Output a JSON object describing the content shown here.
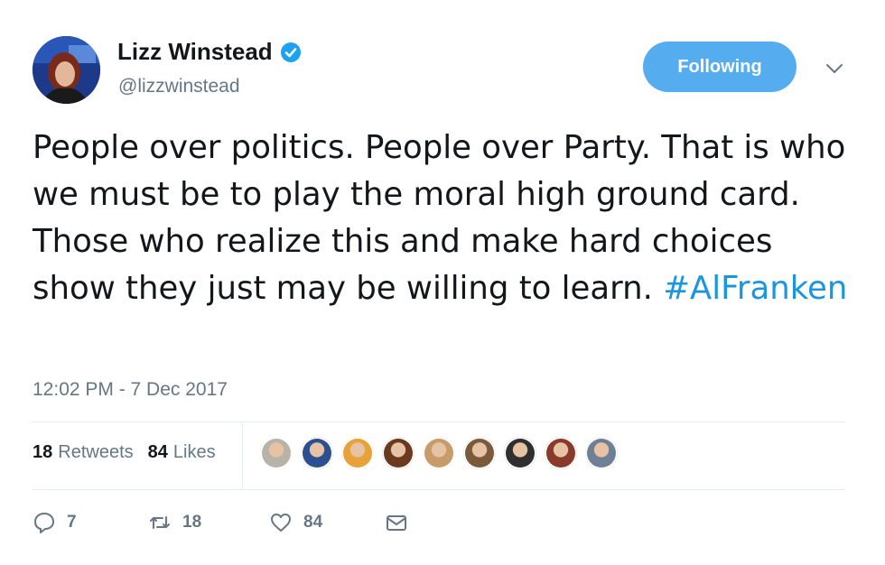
{
  "author": {
    "name": "Lizz Winstead",
    "handle": "@lizzwinstead",
    "verified": true
  },
  "follow_button": {
    "label": "Following"
  },
  "tweet": {
    "text": "People over politics. People over Party. That is who we must be to play the moral high ground card. Those who realize this and make hard choices show they just may be willing to learn.",
    "hashtag": "#AlFranken",
    "timestamp": "12:02 PM - 7 Dec 2017"
  },
  "stats": {
    "retweets_count": "18",
    "retweets_label": "Retweets",
    "likes_count": "84",
    "likes_label": "Likes"
  },
  "likers": [
    {
      "name": "liker-1",
      "color": "#b9b2a8"
    },
    {
      "name": "liker-2",
      "color": "#2b4f8f"
    },
    {
      "name": "liker-3",
      "color": "#e8a23a"
    },
    {
      "name": "liker-4",
      "color": "#6a3a1e"
    },
    {
      "name": "liker-5",
      "color": "#c79b6a"
    },
    {
      "name": "liker-6",
      "color": "#7a5a3a"
    },
    {
      "name": "liker-7",
      "color": "#2f2f2f"
    },
    {
      "name": "liker-8",
      "color": "#8a3a2a"
    },
    {
      "name": "liker-9",
      "color": "#6f7f95"
    }
  ],
  "actions": {
    "reply_count": "7",
    "retweet_count": "18",
    "like_count": "84"
  },
  "colors": {
    "accent": "#1b95e0",
    "button": "#55acee",
    "muted": "#657786"
  }
}
